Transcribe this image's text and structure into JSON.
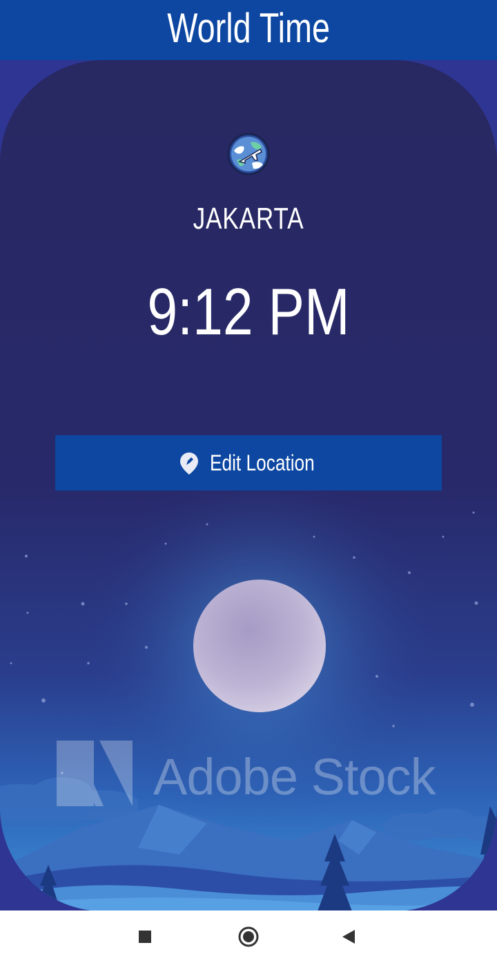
{
  "app_bar": {
    "title": "World Time"
  },
  "location": {
    "city": "JAKARTA",
    "time": "9:12 PM",
    "flag_icon": "globe-airplane-icon",
    "is_daytime": false
  },
  "actions": {
    "edit_location_label": "Edit Location",
    "edit_location_icon": "location-pin-icon"
  },
  "background": {
    "scene": "night-moon-mountains",
    "watermark": "Adobe Stock"
  },
  "nav_bar": {
    "recents_icon": "square-icon",
    "home_icon": "circle-icon",
    "back_icon": "triangle-back-icon"
  },
  "colors": {
    "primary": "#0d47a1",
    "card_bg": "#282862",
    "page_bg": "#2e3592",
    "text": "#ffffff"
  }
}
